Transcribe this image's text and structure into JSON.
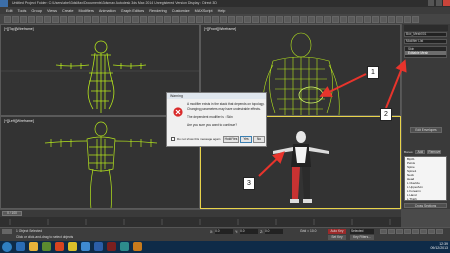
{
  "window": {
    "title": "Untitled    Project Folder: C:\\Users\\abel\\3dsMax\\Documents\\3dsmax    Autodesk 3ds Max 2014    Unregistered Version    Display : Direct 3D"
  },
  "menu": [
    "Edit",
    "Tools",
    "Group",
    "Views",
    "Create",
    "Modifiers",
    "Animation",
    "Graph Editors",
    "Rendering",
    "Customize",
    "MAXScript",
    "Help"
  ],
  "viewports": [
    {
      "label": "[+][Top][Wireframe]"
    },
    {
      "label": "[+][Front][Wireframe]"
    },
    {
      "label": "[+][Left][Wireframe]"
    },
    {
      "label": "[+][Perspective][Realistic]"
    }
  ],
  "right_panel": {
    "name_value": "Box_Mesh001",
    "modifier_list": "Modifier List",
    "stack": [
      "Skin",
      "Editable Mesh"
    ],
    "edit_envelopes": "Edit Envelopes",
    "tabs": [
      "Bones:",
      "Add",
      "Remove"
    ],
    "bones": [
      "Bip01",
      "Pelvis",
      "Spine",
      "Spine1",
      "Neck",
      "Head",
      "L Clavicle",
      "L UpperArm",
      "L Forearm",
      "L Hand",
      "L Thigh"
    ],
    "param_label": "Cross Sections"
  },
  "dialog": {
    "title": "Warning",
    "line1": "A modifier exists in the stack that depends on topology.",
    "line2": "Changing parameters may have undesirable effects.",
    "line3": "The dependent modifier is :   Skin",
    "line4": "Are you sure you want to continue?",
    "checkbox": "Do not show this message again",
    "hold_label": "Hold/Yes",
    "yes_label": "Yes",
    "no_label": "No"
  },
  "callouts": [
    "1",
    "2",
    "3"
  ],
  "timeline": {
    "frame_readout": "0 / 100"
  },
  "status": {
    "selection": "1 Object Selected",
    "hint": "Click or click-and-drag to select objects",
    "x_label": "X:",
    "x_value": "0.0",
    "y_label": "Y:",
    "y_value": "0.0",
    "z_label": "Z:",
    "z_value": "0.0",
    "grid": "Grid = 10.0",
    "auto_key": "Auto Key",
    "selected": "Selected",
    "set_key": "Set Key",
    "key_filters": "Key Filters..."
  },
  "taskbar": {
    "time": "12:39",
    "date": "09/12/2013"
  },
  "colors": {
    "wire": "#b5e61d",
    "selected": "#ffffff",
    "arrow": "#e8342c",
    "viewport_active": "#e8d34a"
  }
}
